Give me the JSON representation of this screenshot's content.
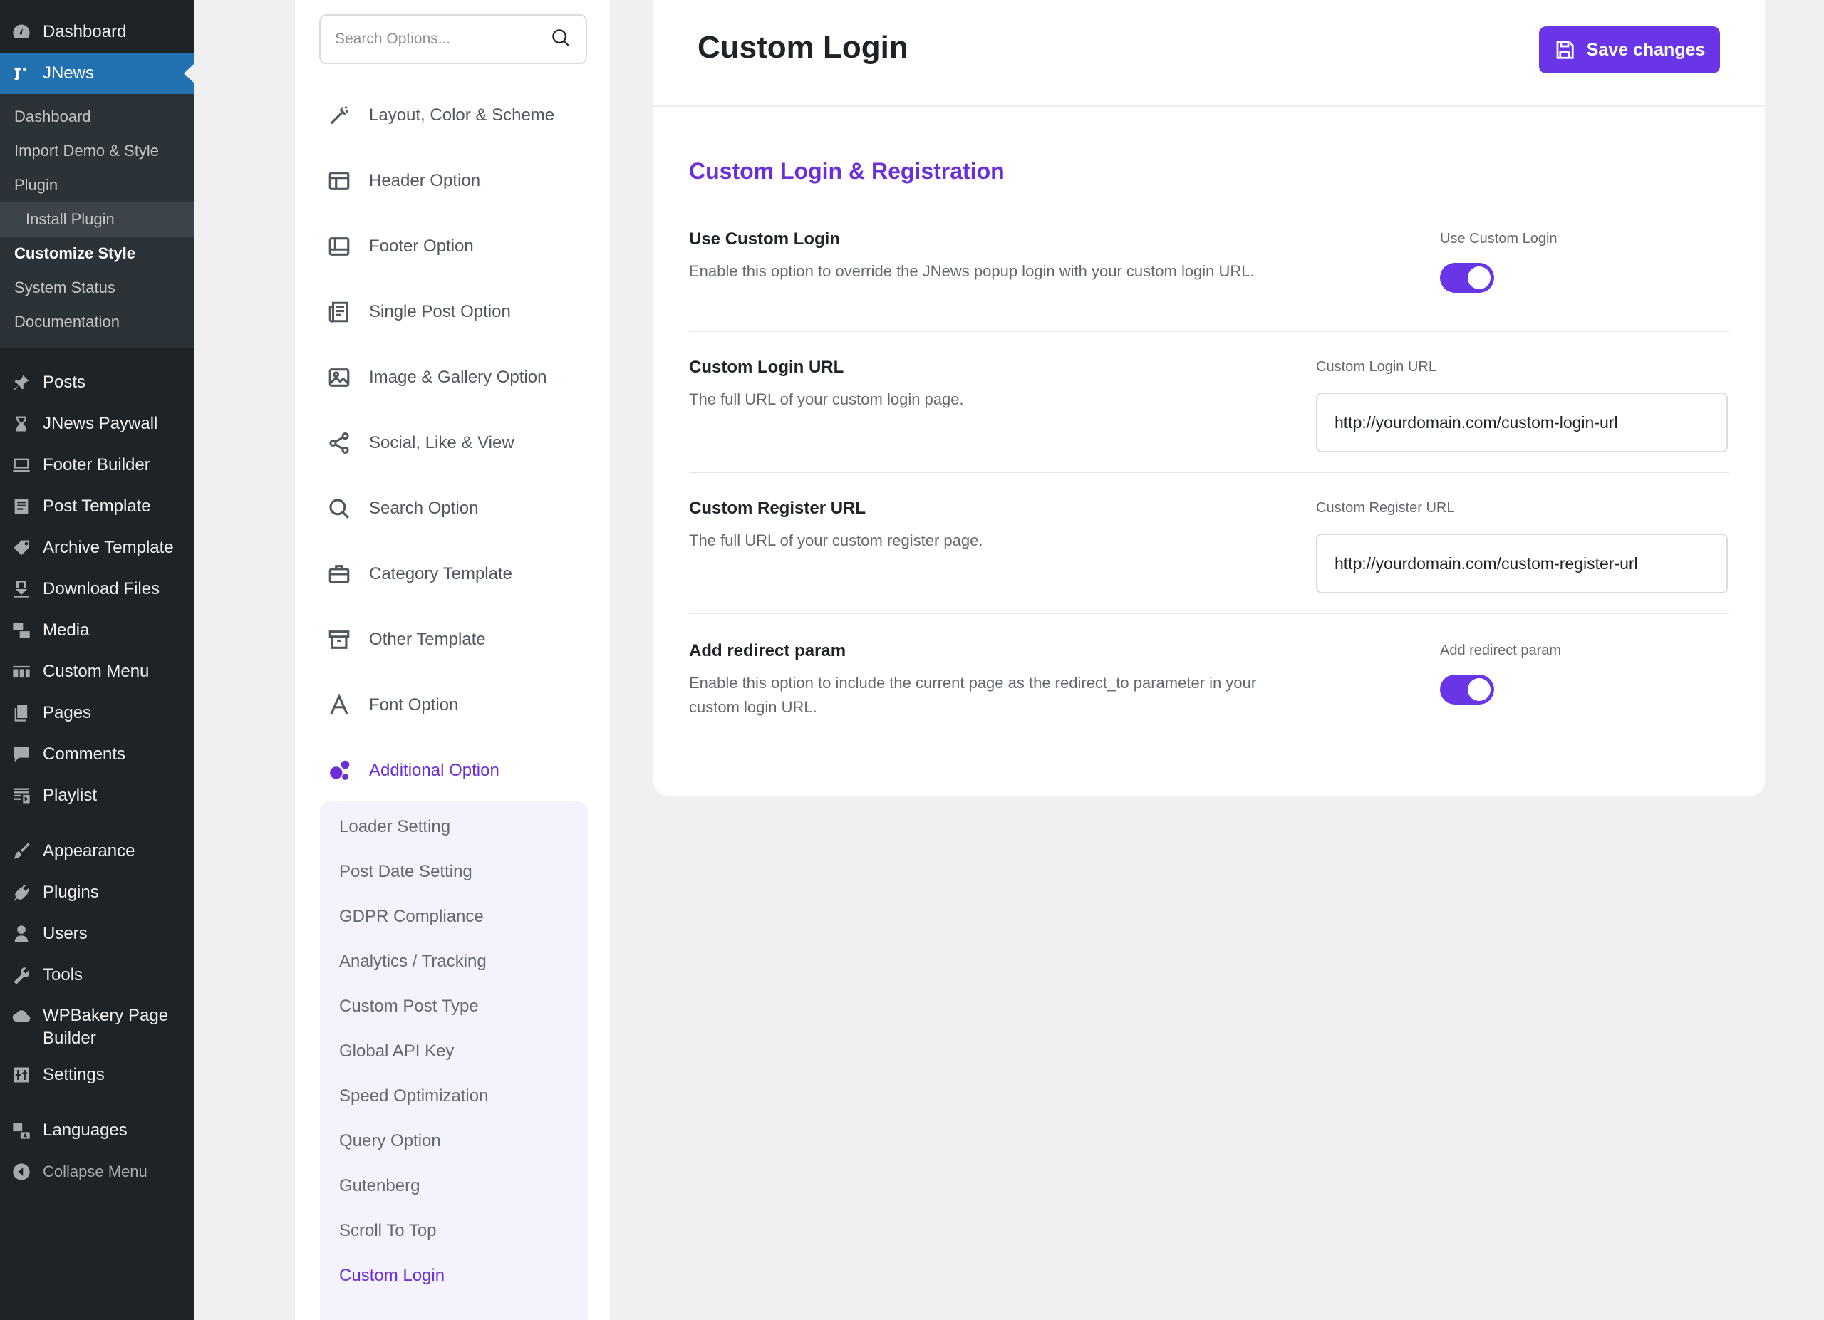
{
  "wp_menu": {
    "dashboard": "Dashboard",
    "jnews": "JNews",
    "submenu": {
      "dashboard": "Dashboard",
      "import_demo": "Import Demo & Style",
      "plugin": "Plugin",
      "install_plugin": "Install Plugin",
      "customize_style": "Customize Style",
      "system_status": "System Status",
      "documentation": "Documentation"
    },
    "posts": "Posts",
    "jnews_paywall": "JNews Paywall",
    "footer_builder": "Footer Builder",
    "post_template": "Post Template",
    "archive_template": "Archive Template",
    "download_files": "Download Files",
    "media": "Media",
    "custom_menu": "Custom Menu",
    "pages": "Pages",
    "comments": "Comments",
    "playlist": "Playlist",
    "appearance": "Appearance",
    "plugins": "Plugins",
    "users": "Users",
    "tools": "Tools",
    "wpbakery": "WPBakery Page Builder",
    "settings": "Settings",
    "languages": "Languages",
    "collapse": "Collapse Menu"
  },
  "options": {
    "search_placeholder": "Search Options...",
    "items": {
      "layout": "Layout, Color & Scheme",
      "header": "Header Option",
      "footer": "Footer Option",
      "single_post": "Single Post Option",
      "image_gallery": "Image & Gallery Option",
      "social": "Social, Like & View",
      "search": "Search Option",
      "category": "Category Template",
      "other": "Other Template",
      "font": "Font Option",
      "additional": "Additional Option"
    },
    "sub_items": {
      "loader": "Loader Setting",
      "post_date": "Post Date Setting",
      "gdpr": "GDPR Compliance",
      "analytics": "Analytics / Tracking",
      "custom_post_type": "Custom Post Type",
      "global_api": "Global API Key",
      "speed": "Speed Optimization",
      "query": "Query Option",
      "gutenberg": "Gutenberg",
      "scroll_top": "Scroll To Top",
      "custom_login": "Custom Login"
    }
  },
  "main": {
    "title": "Custom Login",
    "save_label": "Save changes",
    "section_title": "Custom Login & Registration",
    "use_custom_login": {
      "label": "Use Custom Login",
      "description": "Enable this option to override the JNews popup login with your custom login URL.",
      "control_label": "Use Custom Login",
      "enabled": true
    },
    "custom_login_url": {
      "label": "Custom Login URL",
      "description": "The full URL of your custom login page.",
      "control_label": "Custom Login URL",
      "value": "http://yourdomain.com/custom-login-url"
    },
    "custom_register_url": {
      "label": "Custom Register URL",
      "description": "The full URL of your custom register page.",
      "control_label": "Custom Register URL",
      "value": "http://yourdomain.com/custom-register-url"
    },
    "add_redirect_param": {
      "label": "Add redirect param",
      "description": "Enable this option to include the current page as the redirect_to parameter in your custom login URL.",
      "control_label": "Add redirect param",
      "enabled": true
    }
  },
  "colors": {
    "accent": "#6a35e6",
    "wp_sidebar": "#1d2327",
    "wp_active": "#2271b1"
  }
}
